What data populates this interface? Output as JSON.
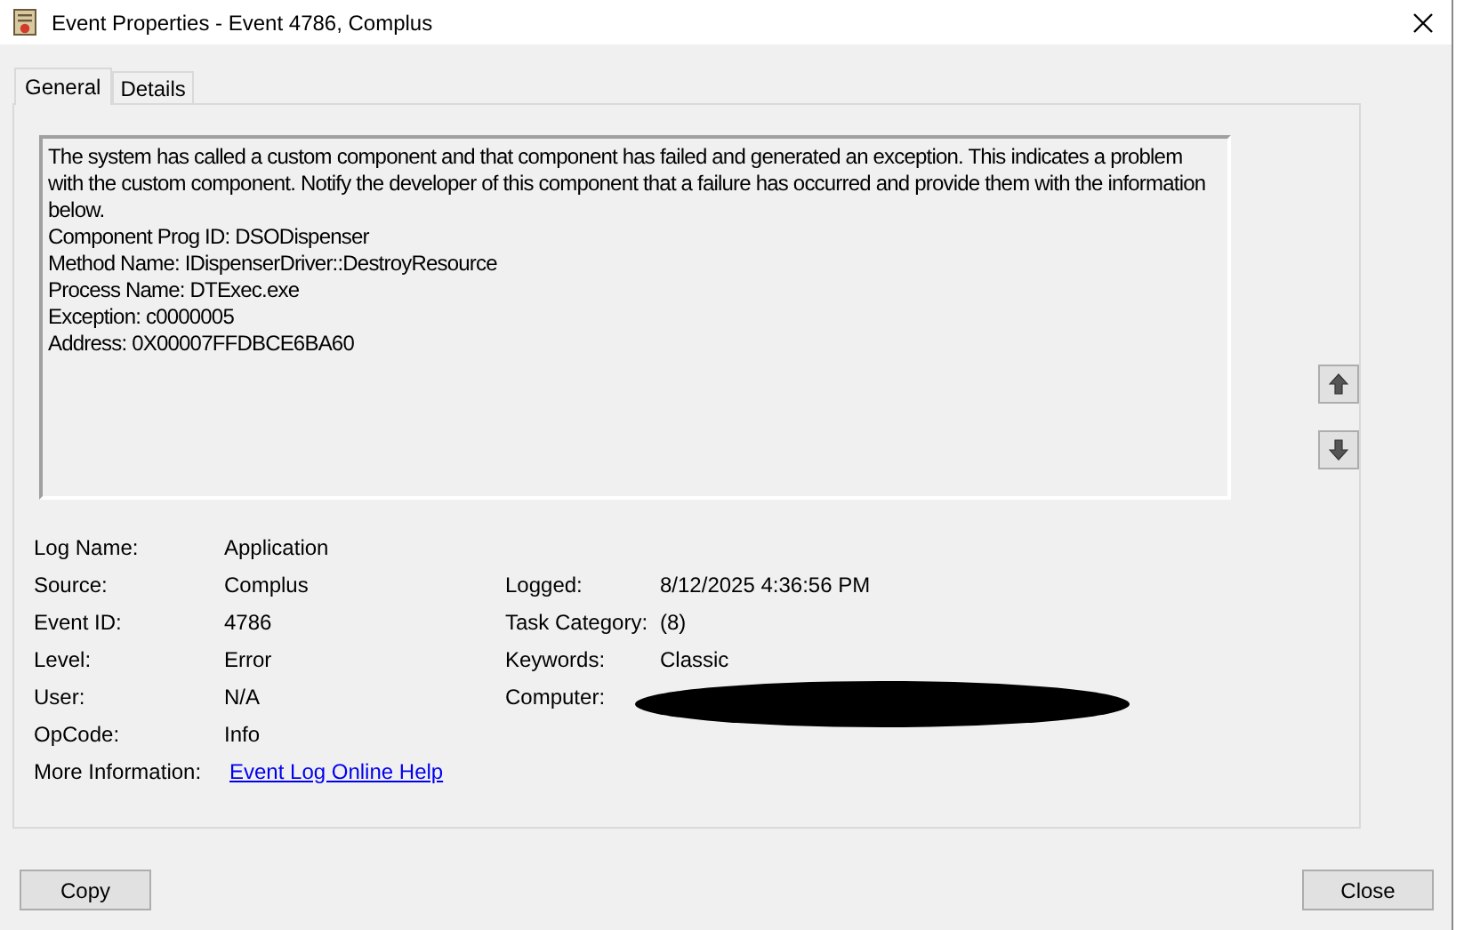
{
  "window": {
    "title": "Event Properties - Event 4786, Complus"
  },
  "tabs": [
    {
      "label": "General",
      "selected": true
    },
    {
      "label": "Details",
      "selected": false
    }
  ],
  "description": {
    "paragraphs": [
      "The system has called a custom component and that component has failed and generated an exception. This indicates a problem with the custom component. Notify the developer of this component that a failure has occurred and provide them with the information below.",
      "Component Prog ID: DSODispenser",
      "Method Name: IDispenserDriver::DestroyResource",
      "Process Name: DTExec.exe",
      "Exception: c0000005",
      "Address: 0X00007FFDBCE6BA60"
    ]
  },
  "field_rows": [
    {
      "left": {
        "label": "Log Name:",
        "value": "Application"
      }
    },
    {
      "left": {
        "label": "Source:",
        "value": "Complus"
      },
      "right": {
        "label": "Logged:",
        "value": "8/12/2025 4:36:56 PM"
      }
    },
    {
      "left": {
        "label": "Event ID:",
        "value": "4786"
      },
      "right": {
        "label": "Task Category:",
        "value": "(8)"
      }
    },
    {
      "left": {
        "label": "Level:",
        "value": "Error"
      },
      "right": {
        "label": "Keywords:",
        "value": "Classic"
      }
    },
    {
      "left": {
        "label": "User:",
        "value": "N/A"
      },
      "right": {
        "label": "Computer:",
        "redacted": true
      }
    },
    {
      "left": {
        "label": "OpCode:",
        "value": "Info"
      }
    },
    {
      "left": {
        "label": "More Information:",
        "value": "Event Log Online Help",
        "kind": "link"
      }
    }
  ],
  "buttons": [
    {
      "label": "Copy"
    },
    {
      "label": "Close"
    }
  ]
}
